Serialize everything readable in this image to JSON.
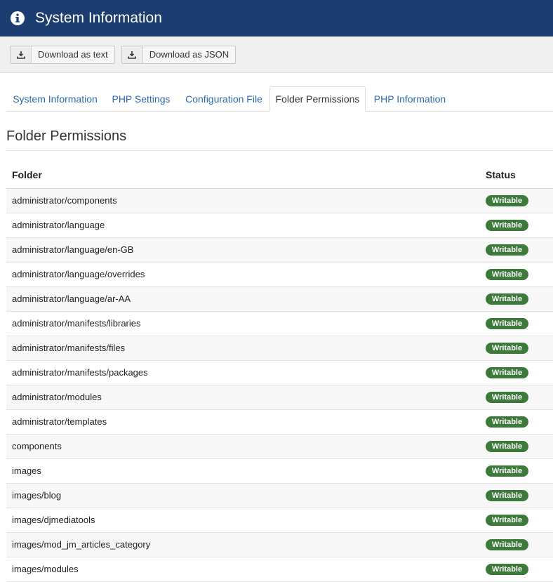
{
  "header": {
    "title": "System Information",
    "icon": "info-icon"
  },
  "toolbar": {
    "download_text_label": "Download as text",
    "download_json_label": "Download as JSON",
    "icon": "download-icon"
  },
  "tabs": [
    {
      "label": "System Information",
      "active": false
    },
    {
      "label": "PHP Settings",
      "active": false
    },
    {
      "label": "Configuration File",
      "active": false
    },
    {
      "label": "Folder Permissions",
      "active": true
    },
    {
      "label": "PHP Information",
      "active": false
    }
  ],
  "main": {
    "section_title": "Folder Permissions",
    "columns": {
      "folder": "Folder",
      "status": "Status"
    },
    "rows": [
      {
        "folder": "administrator/components",
        "status": "Writable"
      },
      {
        "folder": "administrator/language",
        "status": "Writable"
      },
      {
        "folder": "administrator/language/en-GB",
        "status": "Writable"
      },
      {
        "folder": "administrator/language/overrides",
        "status": "Writable"
      },
      {
        "folder": "administrator/language/ar-AA",
        "status": "Writable"
      },
      {
        "folder": "administrator/manifests/libraries",
        "status": "Writable"
      },
      {
        "folder": "administrator/manifests/files",
        "status": "Writable"
      },
      {
        "folder": "administrator/manifests/packages",
        "status": "Writable"
      },
      {
        "folder": "administrator/modules",
        "status": "Writable"
      },
      {
        "folder": "administrator/templates",
        "status": "Writable"
      },
      {
        "folder": "components",
        "status": "Writable"
      },
      {
        "folder": "images",
        "status": "Writable"
      },
      {
        "folder": "images/blog",
        "status": "Writable"
      },
      {
        "folder": "images/djmediatools",
        "status": "Writable"
      },
      {
        "folder": "images/mod_jm_articles_category",
        "status": "Writable"
      },
      {
        "folder": "images/modules",
        "status": "Writable"
      }
    ]
  },
  "colors": {
    "header_bg": "#1c3d6f",
    "tab_link": "#2a69b8",
    "badge_writable": "#3c7a3a"
  }
}
